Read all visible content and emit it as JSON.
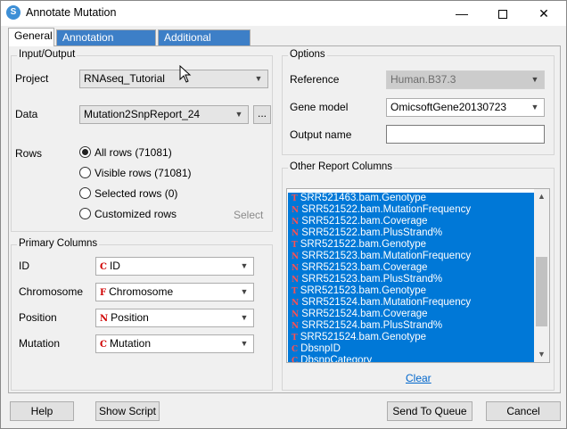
{
  "window": {
    "title": "Annotate Mutation",
    "min_glyph": "—",
    "close_glyph": "✕"
  },
  "tabs": [
    {
      "label": "General",
      "active": true
    },
    {
      "label": "Annotation Sources",
      "active": false
    },
    {
      "label": "Additional Sources",
      "active": false
    }
  ],
  "input_output": {
    "title": "Input/Output",
    "project_label": "Project",
    "project_value": "RNAseq_Tutorial",
    "data_label": "Data",
    "data_value": "Mutation2SnpReport_24",
    "browse_label": "...",
    "rows_label": "Rows",
    "rows_options": [
      {
        "label": "All rows (71081)",
        "checked": true
      },
      {
        "label": "Visible rows (71081)",
        "checked": false
      },
      {
        "label": "Selected rows (0)",
        "checked": false
      },
      {
        "label": "Customized rows",
        "checked": false
      }
    ],
    "select_label": "Select"
  },
  "primary_columns": {
    "title": "Primary Columns",
    "fields": [
      {
        "label": "ID",
        "type_glyph": "C",
        "value": "ID"
      },
      {
        "label": "Chromosome",
        "type_glyph": "F",
        "value": "Chromosome"
      },
      {
        "label": "Position",
        "type_glyph": "N",
        "value": "Position"
      },
      {
        "label": "Mutation",
        "type_glyph": "C",
        "value": "Mutation"
      }
    ]
  },
  "options": {
    "title": "Options",
    "reference_label": "Reference",
    "reference_value": "Human.B37.3",
    "gene_model_label": "Gene model",
    "gene_model_value": "OmicsoftGene20130723",
    "output_name_label": "Output name",
    "output_name_value": ""
  },
  "other_report_columns": {
    "title": "Other Report Columns",
    "items": [
      {
        "type_glyph": "T",
        "label": "SRR521463.bam.Genotype"
      },
      {
        "type_glyph": "N",
        "label": "SRR521522.bam.MutationFrequency"
      },
      {
        "type_glyph": "N",
        "label": "SRR521522.bam.Coverage"
      },
      {
        "type_glyph": "N",
        "label": "SRR521522.bam.PlusStrand%"
      },
      {
        "type_glyph": "T",
        "label": "SRR521522.bam.Genotype"
      },
      {
        "type_glyph": "N",
        "label": "SRR521523.bam.MutationFrequency"
      },
      {
        "type_glyph": "N",
        "label": "SRR521523.bam.Coverage"
      },
      {
        "type_glyph": "N",
        "label": "SRR521523.bam.PlusStrand%"
      },
      {
        "type_glyph": "T",
        "label": "SRR521523.bam.Genotype"
      },
      {
        "type_glyph": "N",
        "label": "SRR521524.bam.MutationFrequency"
      },
      {
        "type_glyph": "N",
        "label": "SRR521524.bam.Coverage"
      },
      {
        "type_glyph": "N",
        "label": "SRR521524.bam.PlusStrand%"
      },
      {
        "type_glyph": "T",
        "label": "SRR521524.bam.Genotype"
      },
      {
        "type_glyph": "C",
        "label": "DbsnpID"
      },
      {
        "type_glyph": "C",
        "label": "DbsnpCategory"
      }
    ],
    "clear_label": "Clear"
  },
  "footer": {
    "help_label": "Help",
    "show_script_label": "Show Script",
    "send_to_queue_label": "Send To Queue",
    "cancel_label": "Cancel"
  },
  "colors": {
    "selection": "#0078d7",
    "tab_inactive": "#3d7fc7",
    "type_glyph": "#d00000",
    "link": "#0066cc"
  }
}
